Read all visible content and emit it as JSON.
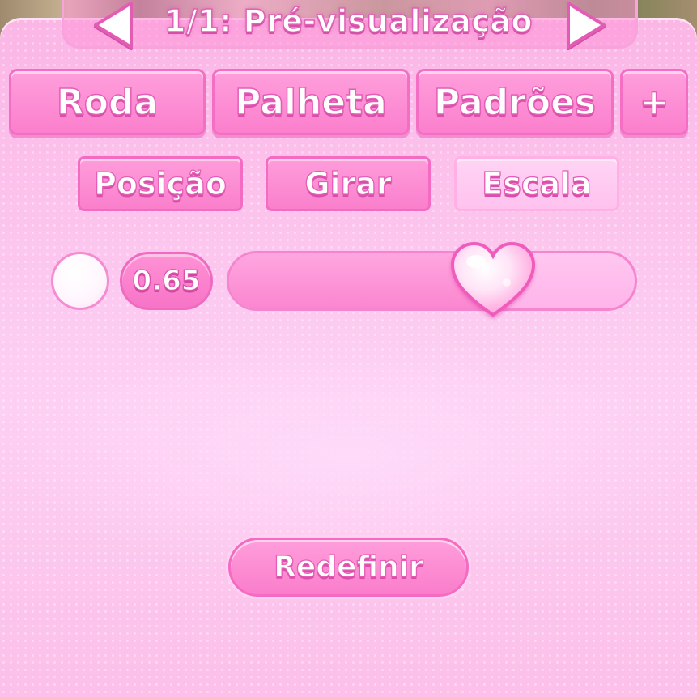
{
  "header": {
    "title": "1/1: Pré-visualização",
    "prev_icon": "arrow-left-icon",
    "next_icon": "arrow-right-icon"
  },
  "tabs": [
    {
      "label": "Roda"
    },
    {
      "label": "Palheta"
    },
    {
      "label": "Padrões"
    },
    {
      "label": "+"
    }
  ],
  "subtabs": [
    {
      "label": "Posição",
      "active": false
    },
    {
      "label": "Girar",
      "active": false
    },
    {
      "label": "Escala",
      "active": true
    }
  ],
  "scale": {
    "value_label": "0.65",
    "slider_fraction": 0.65,
    "color_swatch": "#ffffff",
    "knob_icon": "heart-icon"
  },
  "reset_label": "Redefinir",
  "colors": {
    "panel": "#fcc3ee",
    "accent": "#f774c6",
    "text": "#ffffff"
  }
}
